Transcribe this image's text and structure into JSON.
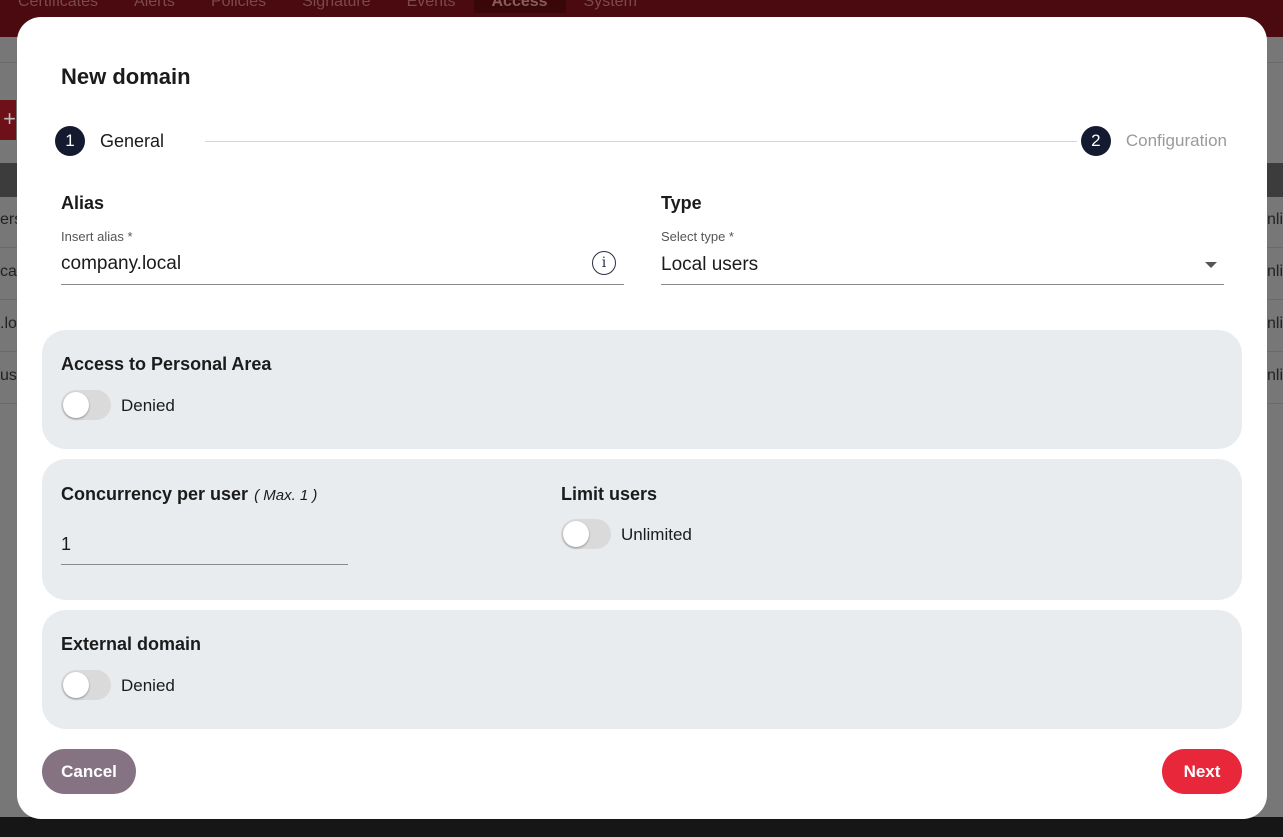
{
  "background": {
    "nav": [
      "Certificates",
      "Alerts",
      "Policies",
      "Signature",
      "Events",
      "Access",
      "System"
    ],
    "active_nav": "Access",
    "rows_left": [
      "ers",
      "ca",
      ".lo",
      "use"
    ],
    "rows_right": [
      "nli",
      "nli",
      "nli",
      "nli"
    ],
    "add_glyph": "+"
  },
  "modal": {
    "title": "New domain",
    "steps": [
      {
        "number": "1",
        "label": "General"
      },
      {
        "number": "2",
        "label": "Configuration"
      }
    ],
    "alias": {
      "title": "Alias",
      "caption": "Insert alias *",
      "value": "company.local",
      "info_glyph": "i"
    },
    "type": {
      "title": "Type",
      "caption": "Select type *",
      "value": "Local users"
    },
    "personal_area": {
      "title": "Access to Personal Area",
      "toggle_label": "Denied",
      "enabled": false
    },
    "concurrency": {
      "title": "Concurrency per user",
      "note": "( Max. 1 )",
      "value": "1"
    },
    "limit_users": {
      "title": "Limit users",
      "toggle_label": "Unlimited",
      "enabled": false
    },
    "external_domain": {
      "title": "External domain",
      "toggle_label": "Denied",
      "enabled": false
    },
    "buttons": {
      "cancel": "Cancel",
      "next": "Next"
    }
  },
  "colors": {
    "accent": "#e8273a",
    "cancel": "#857383",
    "step_circle": "#141a30",
    "panel": "#e8ecef"
  }
}
